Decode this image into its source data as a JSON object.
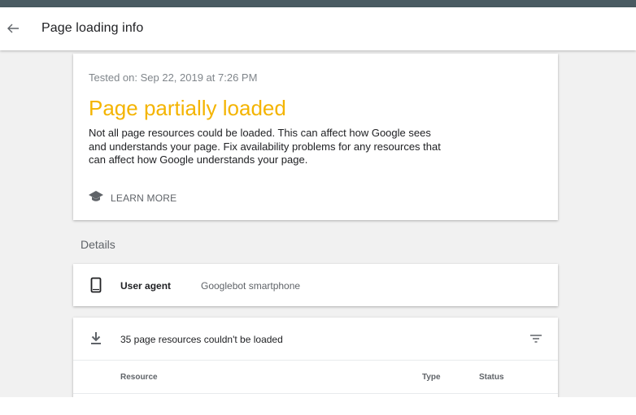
{
  "header": {
    "title": "Page loading info",
    "back_icon": "arrow-back-icon"
  },
  "status": {
    "tested_on": "Tested on: Sep 22, 2019 at 7:26 PM",
    "headline": "Page partially loaded",
    "headline_color": "#f4b400",
    "description": "Not all page resources could be loaded. This can affect how Google sees and understands your page. Fix availability problems for any resources that can affect how Google understands your page.",
    "learn_more_label": "LEARN MORE",
    "learn_more_icon": "school-icon"
  },
  "details": {
    "heading": "Details",
    "user_agent_label": "User agent",
    "user_agent_value": "Googlebot smartphone",
    "user_agent_icon": "smartphone-icon"
  },
  "resources": {
    "title": "35 page resources couldn't be loaded",
    "icon": "download-icon",
    "filter_icon": "filter-icon",
    "columns": [
      "Resource",
      "Type",
      "Status"
    ]
  }
}
